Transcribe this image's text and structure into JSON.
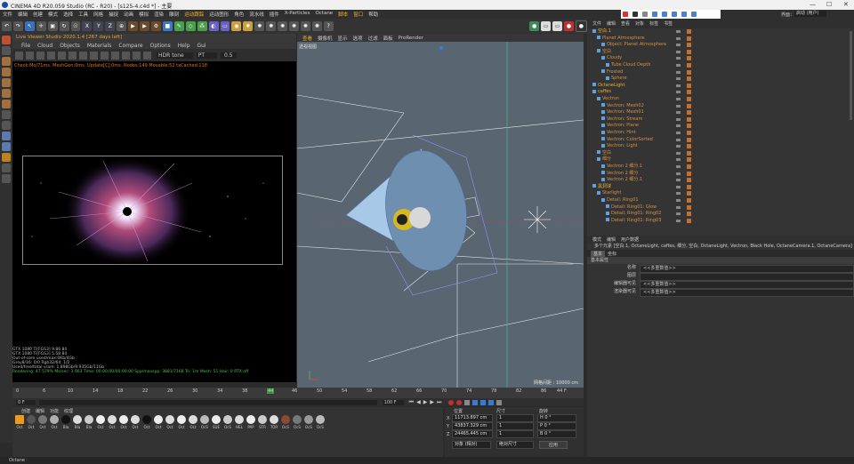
{
  "window": {
    "title": "CINEMA 4D R20.059 Studio (RC - R20) - [s125-4.c4d *] - 主要",
    "controls": [
      "—",
      "☐",
      "✕"
    ]
  },
  "menubar": {
    "items": [
      "文件",
      "编辑",
      "创建",
      "模式",
      "选择",
      "工具",
      "网格",
      "捕捉",
      "动画",
      "模拟",
      "渲染",
      "雕刻",
      "运动跟踪",
      "运动图形",
      "角色",
      "流水线",
      "插件",
      "X-Particles",
      "Octane",
      "脚本",
      "窗口",
      "帮助"
    ],
    "layout_label": "界面：",
    "layout_value": "启动 (用户)"
  },
  "live_viewer": {
    "title": "Live Viewer Studio 2020.1.4 [267 days left]",
    "menu": [
      "File",
      "Cloud",
      "Objects",
      "Materials",
      "Compare",
      "Options",
      "Help",
      "Gui"
    ],
    "hdr_mode": "HDR tone",
    "channel": "PT",
    "value": "0.5",
    "status": "Check:Mo/71ms. MeshGen:0ms. Update[C]:0ms. Nodes:149 Movable:52 txCached:118",
    "stats": [
      "GTX 1080 Ti[FGS3]      9.86    84",
      "GTX 1080 Ti[FGS3]      5.58    84",
      "Out-of-core used/max:0Kb/4Gb",
      "Grey8/16: 0/0         Rgb32/64: 1/2",
      "Used/free/total vram: 1.898Gb/9.935Gb/11Gb",
      "Rendering: 47.579%  Ms/sec: 3.903  Time: 00:00:00/00:00:00  Spp/maxspp: 3881/7168  Tri: 1m  Mesh: 51  Hair: 0  RTX:off"
    ]
  },
  "viewport": {
    "tabs": [
      "查看",
      "摄像机",
      "显示",
      "选项",
      "过滤",
      "面板",
      "ProRender"
    ],
    "camera_label": "透视视图",
    "grid_label": "网格间距 : 10000 cm"
  },
  "timeline": {
    "ticks": [
      "0",
      "2",
      "4",
      "6",
      "8",
      "10",
      "12",
      "14",
      "16",
      "18",
      "20",
      "22",
      "24",
      "26",
      "28",
      "30",
      "32",
      "34",
      "36",
      "38",
      "40",
      "42",
      "44",
      "46",
      "48",
      "50",
      "52",
      "54",
      "56",
      "58",
      "60",
      "62",
      "64",
      "66",
      "68",
      "70",
      "72",
      "74",
      "76",
      "78",
      "80",
      "82",
      "84",
      "86",
      "88",
      "90",
      "92",
      "94",
      "96",
      "98",
      "100"
    ],
    "current_frame": "44 F",
    "start": "0 F",
    "end": "100 F"
  },
  "material_manager": {
    "menu": [
      "创建",
      "编辑",
      "功能",
      "纹理"
    ],
    "materials": [
      "Oct",
      "Oct",
      "Oct",
      "Oct",
      "Bla",
      "Bla",
      "Bla",
      "Oct",
      "Oct",
      "Oct",
      "Oct",
      "Oct",
      "Oct",
      "Oct",
      "Oct",
      "Oct",
      "OcS",
      "SUE",
      "OcS",
      "HEL",
      "PAP",
      "STR",
      "TOR",
      "OcS",
      "OcS",
      "OcS",
      "OcS"
    ]
  },
  "coordinates": {
    "headers": [
      "位置",
      "尺寸",
      "旋转"
    ],
    "rows": [
      {
        "axis": "X",
        "pos": "11713.897 cm",
        "size": "1",
        "rot": "H  0 °"
      },
      {
        "axis": "Y",
        "pos": "43837.329 cm",
        "size": "1",
        "rot": "P  0 °"
      },
      {
        "axis": "Z",
        "pos": "24465.445 cm",
        "size": "1",
        "rot": "B  0 °"
      }
    ],
    "mode": "对象 (相对)",
    "size_mode": "绝对尺寸",
    "apply_label": "应用"
  },
  "object_manager": {
    "menu": [
      "文件",
      "编辑",
      "查看",
      "对象",
      "标签",
      "书签"
    ],
    "objects": [
      {
        "name": "空白.1",
        "indent": 0
      },
      {
        "name": "Planet Atmosphere",
        "indent": 1
      },
      {
        "name": "Object: Planet Atmosphere",
        "indent": 2
      },
      {
        "name": "空白",
        "indent": 1
      },
      {
        "name": "Cloudy",
        "indent": 2
      },
      {
        "name": "Tube Cloud Depth",
        "indent": 3
      },
      {
        "name": "Frosted",
        "indent": 2
      },
      {
        "name": "Sphere",
        "indent": 3
      },
      {
        "name": "OctaneLight",
        "indent": 0
      },
      {
        "name": "caffes",
        "indent": 0
      },
      {
        "name": "Vectron",
        "indent": 1
      },
      {
        "name": "Vectron: Mesh02",
        "indent": 2
      },
      {
        "name": "Vectron: Mesh01",
        "indent": 2
      },
      {
        "name": "Vectron: Stream",
        "indent": 2
      },
      {
        "name": "Vectron: Plane",
        "indent": 2
      },
      {
        "name": "Vectron: Hint",
        "indent": 2
      },
      {
        "name": "Vectron: ColorSorted",
        "indent": 2
      },
      {
        "name": "Vectron: Light",
        "indent": 2
      },
      {
        "name": "空白",
        "indent": 1
      },
      {
        "name": "细分",
        "indent": 1
      },
      {
        "name": "Vectron 2 细分.1",
        "indent": 2
      },
      {
        "name": "Vectron 2 细分",
        "indent": 2
      },
      {
        "name": "Vectron 2 细分.1",
        "indent": 2
      },
      {
        "name": "黑洞球",
        "indent": 0
      },
      {
        "name": "Starlight",
        "indent": 1
      },
      {
        "name": "Detail: Ring01",
        "indent": 2
      },
      {
        "name": "Detail: Ring01: Glow",
        "indent": 3
      },
      {
        "name": "Detail: Ring01: Ring02",
        "indent": 3
      },
      {
        "name": "Detail: Ring01: Ring03",
        "indent": 3
      }
    ]
  },
  "attribute_manager": {
    "menu": [
      "模式",
      "编辑",
      "用户数据"
    ],
    "tabs": [
      "基本",
      "坐标"
    ],
    "path": "多个元素 [空白.1, OctaneLight, caffes, 细分, 空白, OctaneLight, Vectron, Black Hole, OctaneCamera.1, OctaneCamera]",
    "section": "基本属性",
    "fields": [
      {
        "label": "名称",
        "value": "<<多重数值>>"
      },
      {
        "label": "图层",
        "value": ""
      },
      {
        "label": "编辑器可见",
        "value": "<<多重数值>>"
      },
      {
        "label": "渲染器可见",
        "value": "<<多重数值>>"
      }
    ]
  },
  "statusbar": {
    "text": "Octane"
  },
  "colors": {
    "accent_orange": "#e6a040",
    "viewport_bg": "#596570",
    "selection_blue": "#5fa0e0"
  }
}
